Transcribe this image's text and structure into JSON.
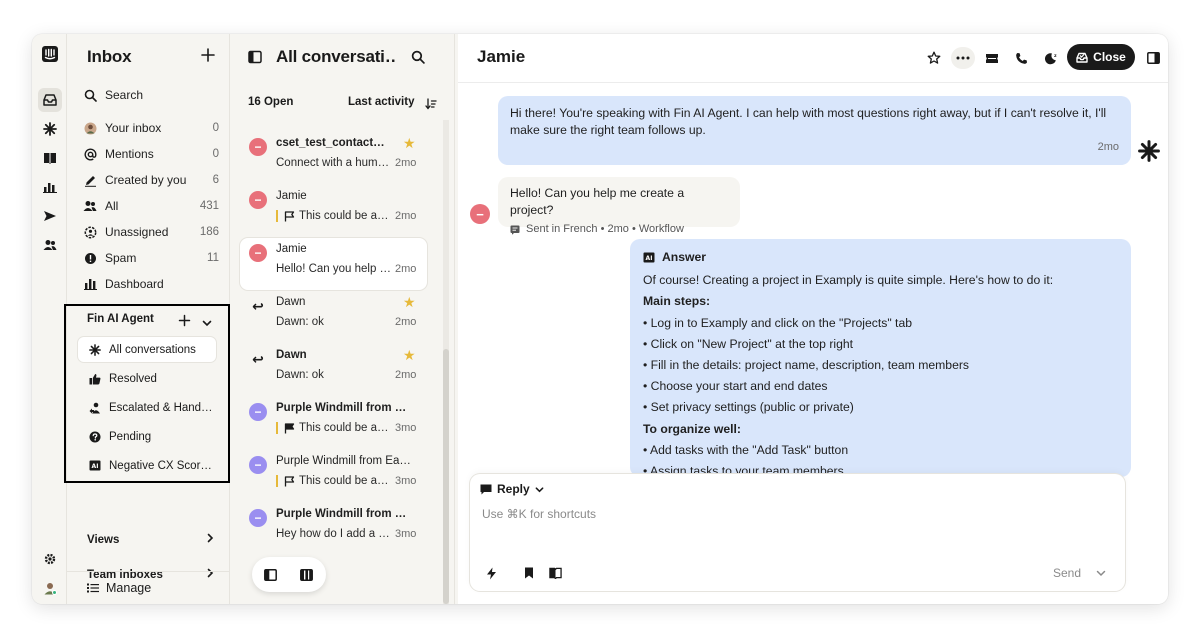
{
  "nav": {
    "title": "Inbox",
    "search": "Search",
    "items": [
      {
        "label": "Your inbox",
        "count": "0",
        "icon": "avatar-icon"
      },
      {
        "label": "Mentions",
        "count": "0",
        "icon": "at-icon"
      },
      {
        "label": "Created by you",
        "count": "6",
        "icon": "pencil-icon"
      },
      {
        "label": "All",
        "count": "431",
        "icon": "users-icon"
      },
      {
        "label": "Unassigned",
        "count": "186",
        "icon": "unassigned-icon"
      },
      {
        "label": "Spam",
        "count": "11",
        "icon": "spam-icon"
      },
      {
        "label": "Dashboard",
        "count": "",
        "icon": "bar-chart-icon"
      }
    ],
    "fin": {
      "title": "Fin AI Agent",
      "items": [
        {
          "label": "All conversations",
          "icon": "fin-icon"
        },
        {
          "label": "Resolved",
          "icon": "thumbs-up-icon"
        },
        {
          "label": "Escalated & Hand…",
          "icon": "escalated-icon"
        },
        {
          "label": "Pending",
          "icon": "question-icon"
        },
        {
          "label": "Negative CX Scor…",
          "icon": "ai-icon"
        }
      ]
    },
    "views": "Views",
    "team_inboxes": "Team inboxes",
    "manage": "Manage"
  },
  "list": {
    "title": "All conversati…",
    "open_count": "16 Open",
    "sort": "Last activity",
    "conversations": [
      {
        "name": "cset_test_contact@…",
        "preview": "Connect with a hum…",
        "time": "2mo",
        "avatar_color": "#e8707a",
        "avatar": "−",
        "starred": true,
        "bold": true,
        "flag": false
      },
      {
        "name": "Jamie",
        "preview": "This could be a…",
        "time": "2mo",
        "avatar_color": "#e8707a",
        "avatar": "−",
        "starred": false,
        "bold": false,
        "flag": "outline"
      },
      {
        "name": "Jamie",
        "preview": "Hello! Can you help …",
        "time": "2mo",
        "avatar_color": "#e8707a",
        "avatar": "−",
        "starred": false,
        "bold": false,
        "flag": false,
        "selected": true
      },
      {
        "name": "Dawn",
        "preview": "Dawn: ok",
        "time": "2mo",
        "avatar_color": "",
        "avatar": "↩",
        "starred": true,
        "bold": false,
        "flag": false
      },
      {
        "name": "Dawn",
        "preview": "Dawn: ok",
        "time": "2mo",
        "avatar_color": "",
        "avatar": "↩",
        "starred": true,
        "bold": true,
        "flag": false
      },
      {
        "name": "Purple Windmill from Ea…",
        "preview": "This could be a…",
        "time": "3mo",
        "avatar_color": "#9a8ef0",
        "avatar": "−",
        "starred": false,
        "bold": true,
        "flag": "solid"
      },
      {
        "name": "Purple Windmill from Ea…",
        "preview": "This could be a…",
        "time": "3mo",
        "avatar_color": "#9a8ef0",
        "avatar": "−",
        "starred": false,
        "bold": false,
        "flag": "outline"
      },
      {
        "name": "Purple Windmill from Ea…",
        "preview": "Hey how do I add a t…",
        "time": "3mo",
        "avatar_color": "#9a8ef0",
        "avatar": "−",
        "starred": false,
        "bold": true,
        "flag": false
      }
    ]
  },
  "main": {
    "title": "Jamie",
    "close_label": "Close",
    "messages": {
      "bot_greeting": "Hi there! You're speaking with Fin AI Agent. I can help with most questions right away, but if I can't resolve it, I'll make sure the right team follows up.",
      "bot_greeting_time": "2mo",
      "user_text": "Hello! Can you help me create a project?",
      "user_meta": "Sent in French • 2mo • Workflow",
      "answer_label": "Answer",
      "answer_intro": "Of course! Creating a project in Examply is quite simple. Here's how to do it:",
      "answer_heading1": "Main steps:",
      "answer_steps1": [
        "• Log in to Examply and click on the \"Projects\" tab",
        "• Click on \"New Project\" at the top right",
        "• Fill in the details: project name, description, team members",
        "• Choose your start and end dates",
        "• Set privacy settings (public or private)"
      ],
      "answer_heading2": "To organize well:",
      "answer_steps2": [
        "• Add tasks with the \"Add Task\" button",
        "• Assign tasks to your team members"
      ]
    },
    "composer": {
      "mode": "Reply",
      "placeholder": "Use ⌘K for shortcuts",
      "send": "Send"
    }
  }
}
